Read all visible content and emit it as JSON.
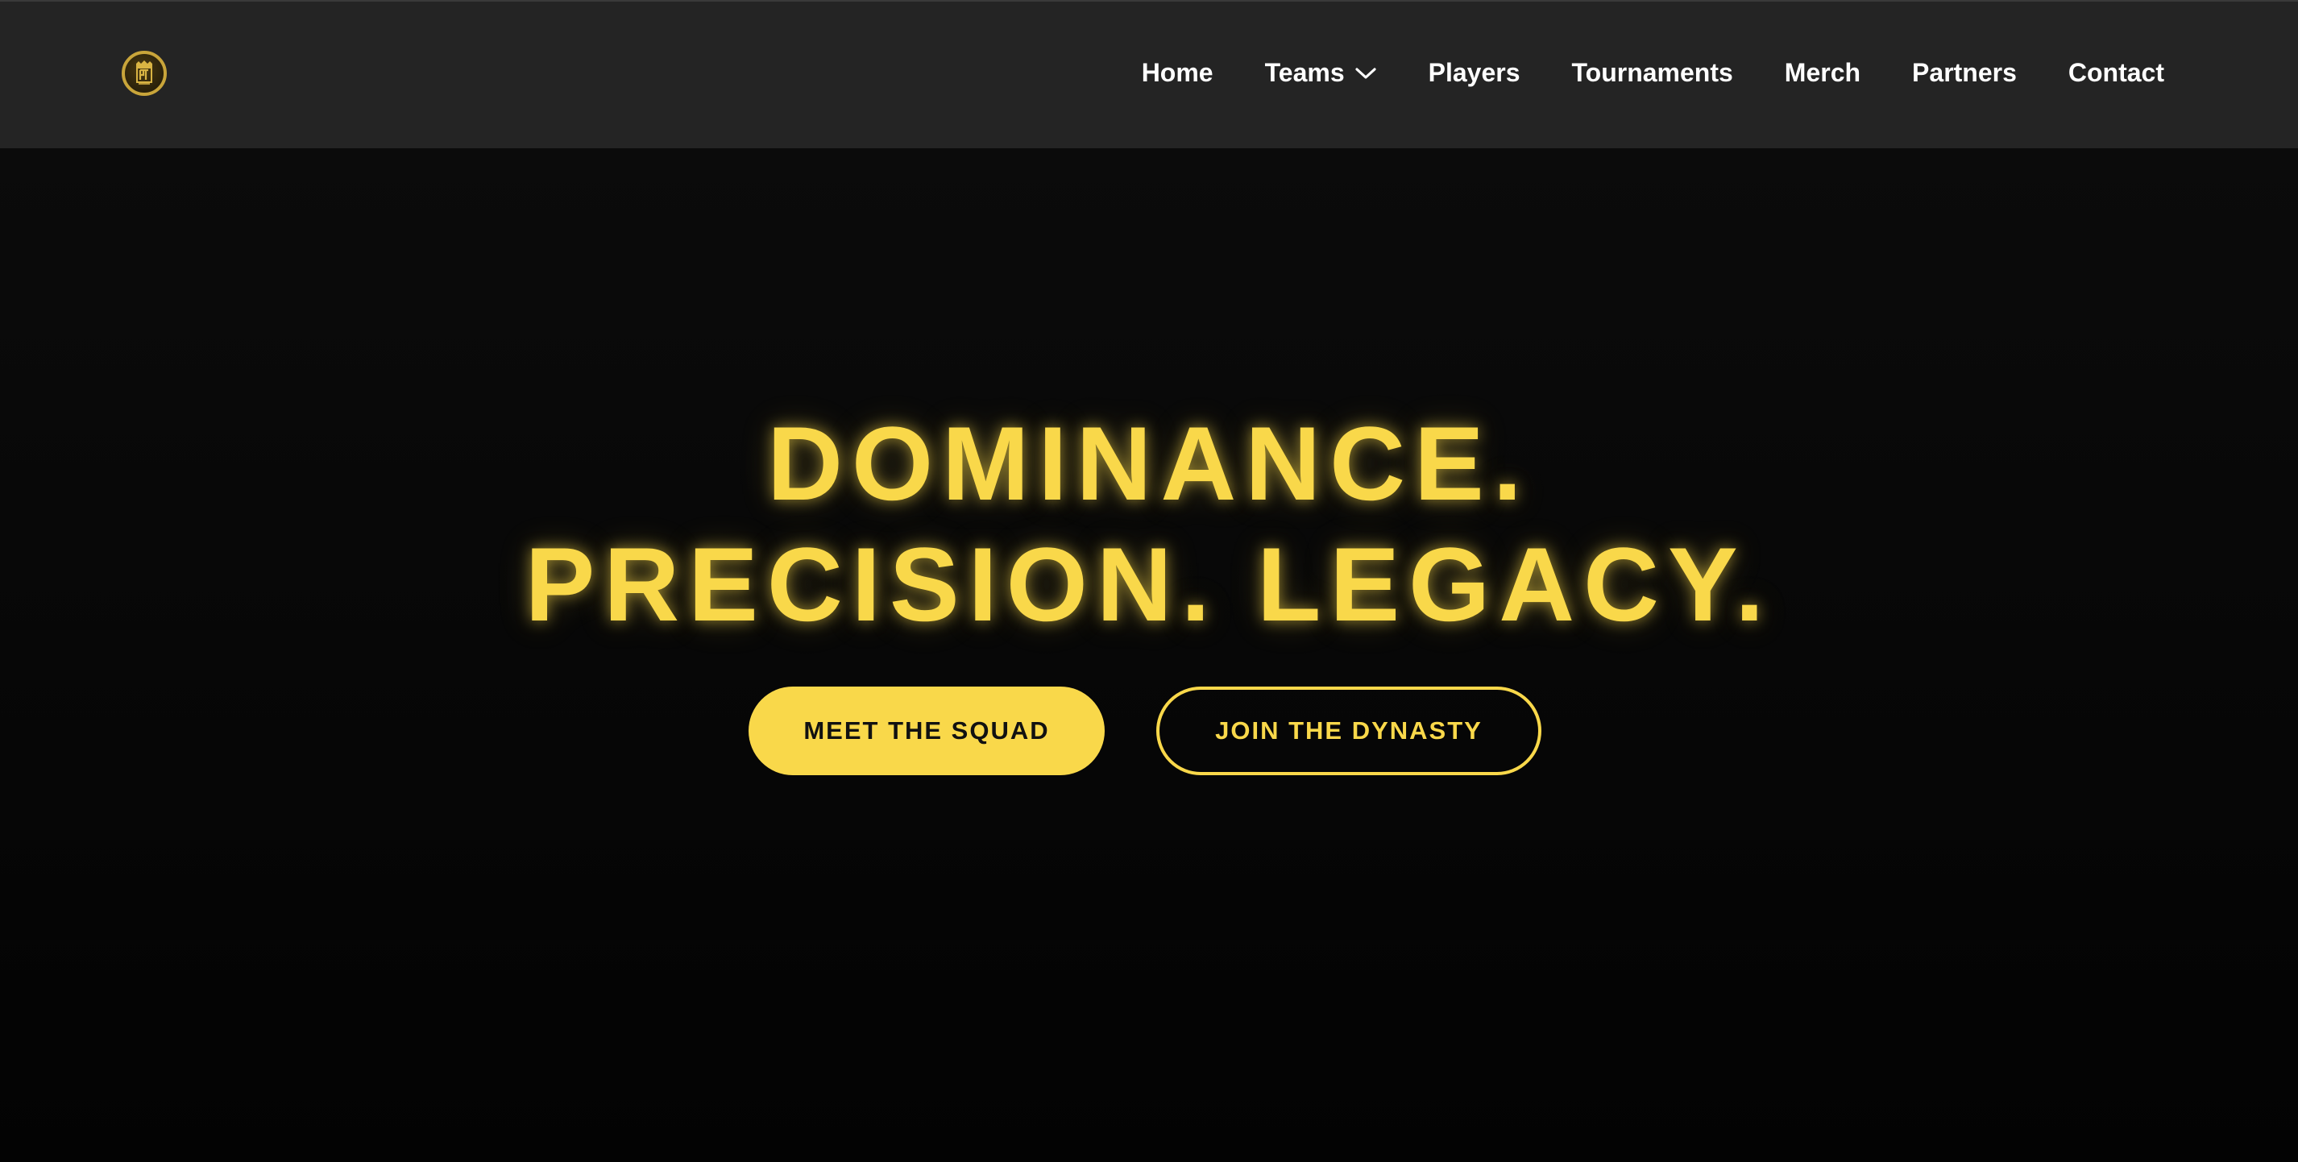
{
  "brand": {
    "logo_icon": "crest-logo-icon",
    "accent_color": "#f9d84a"
  },
  "nav": {
    "items": [
      {
        "label": "Home"
      },
      {
        "label": "Teams",
        "icon": "chevron-down-icon"
      },
      {
        "label": "Players"
      },
      {
        "label": "Tournaments"
      },
      {
        "label": "Merch"
      },
      {
        "label": "Partners"
      },
      {
        "label": "Contact"
      }
    ]
  },
  "hero": {
    "headline_line1": "DOMINANCE.",
    "headline_line2": "PRECISION. LEGACY.",
    "primary_button": "MEET THE SQUAD",
    "secondary_button": "JOIN THE DYNASTY"
  },
  "colors": {
    "navbar_bg": "#242424",
    "hero_bg": "#050505",
    "nav_text": "#ffffff"
  }
}
